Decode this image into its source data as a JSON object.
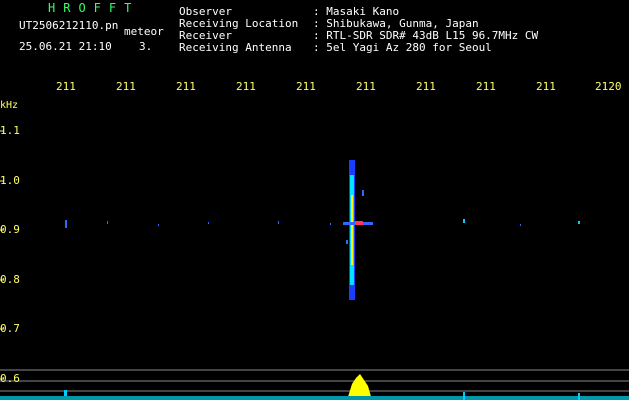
{
  "header": {
    "program": "HROFFT",
    "filename": "UT2506212110.pn",
    "mode": "meteor",
    "datetime": "25.06.21 21:10",
    "count": "3.",
    "observer_label": "Observer",
    "observer_value": ": Masaki Kano",
    "location_label": "Receiving Location",
    "location_value": ": Shibukawa, Gunma, Japan",
    "receiver_label": "Receiver",
    "receiver_value": ": RTL-SDR SDR# 43dB L15 96.7MHz CW",
    "antenna_label": "Receiving Antenna",
    "antenna_value": ": 5el Yagi Az 280 for Seoul"
  },
  "time_axis": {
    "labels": [
      "211",
      "211",
      "211",
      "211",
      "211",
      "211",
      "211",
      "211",
      "211",
      "2120"
    ]
  },
  "freq_axis": {
    "unit": "kHz",
    "labels": [
      "1.1",
      "1.0",
      "0.9",
      "0.8",
      "0.7",
      "0.6"
    ]
  },
  "colors": {
    "background": "#000000",
    "header_green": "#33ff66",
    "axis_yellow": "#ffff66",
    "signal_blue": "#3366ff",
    "signal_cyan": "#00ffff",
    "signal_yellow": "#ffff00"
  }
}
